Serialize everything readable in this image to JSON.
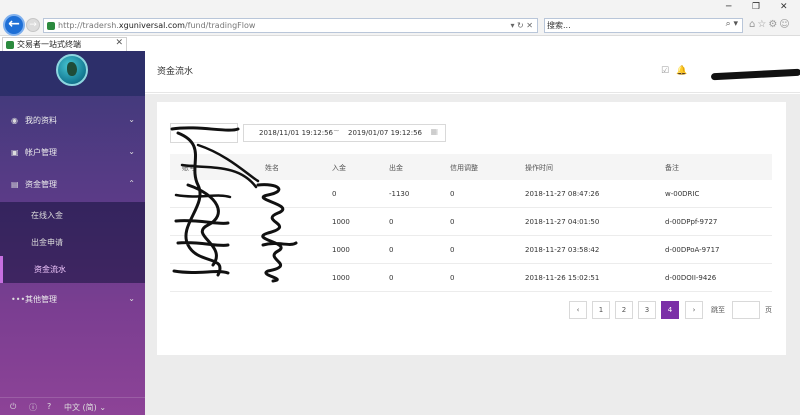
{
  "browser": {
    "url_prefix": "http://tradersh.",
    "url_domain": "xguniversal.com",
    "url_path": "/fund/tradingFlow",
    "address_tools": "▾ ↻ ✕",
    "search_placeholder": "搜索...",
    "search_icon": "⌕ ▾",
    "win_min": "─",
    "win_max": "❐",
    "win_close": "✕",
    "nav_icons": "⌂☆⚙☺",
    "tab_title": "交易者一站式终端",
    "tab_close": "✕"
  },
  "sidebar": {
    "menu": [
      {
        "icon": "◉",
        "label": "我的资料",
        "chevron": "⌄"
      },
      {
        "icon": "▣",
        "label": "帐户管理",
        "chevron": "⌄"
      },
      {
        "icon": "▤",
        "label": "资金管理",
        "chevron": "⌃"
      },
      {
        "icon": "•••",
        "label": "其他管理",
        "chevron": "⌄"
      }
    ],
    "submenu": [
      "在线入金",
      "出金申请",
      "资金流水"
    ],
    "bottom": {
      "power": "⏻",
      "info": "ⓘ",
      "help": "?",
      "language": "中文 (简) ⌄"
    }
  },
  "header": {
    "title": "资金流水",
    "check_icon": "☑",
    "bell_icon": "🔔"
  },
  "filter": {
    "start_date": "2018/11/01 19:12:56",
    "separator": "~",
    "end_date": "2019/01/07 19:12:56",
    "calendar_icon": "▦"
  },
  "table": {
    "columns": [
      "账号",
      "姓名",
      "入金",
      "出金",
      "信用调整",
      "操作时间",
      "备注"
    ],
    "rows": [
      {
        "deposit": "0",
        "withdraw": "-1130",
        "credit": "0",
        "time": "2018-11-27 08:47:26",
        "note": "w-00DRIC"
      },
      {
        "deposit": "1000",
        "withdraw": "0",
        "credit": "0",
        "time": "2018-11-27 04:01:50",
        "note": "d-00DPpf-9727"
      },
      {
        "deposit": "1000",
        "withdraw": "0",
        "credit": "0",
        "time": "2018-11-27 03:58:42",
        "note": "d-00DPoA-9717"
      },
      {
        "deposit": "1000",
        "withdraw": "0",
        "credit": "0",
        "time": "2018-11-26 15:02:51",
        "note": "d-00DOII-9426"
      }
    ]
  },
  "pagination": {
    "prev": "‹",
    "pages": [
      "1",
      "2",
      "3",
      "4"
    ],
    "current": "4",
    "next": "›",
    "jump_label": "跳至",
    "page_label": "页"
  },
  "colors": {
    "accent": "#7b2fa7",
    "sidebar_top": "#3b3a78",
    "sidebar_bottom": "#8d4397"
  }
}
